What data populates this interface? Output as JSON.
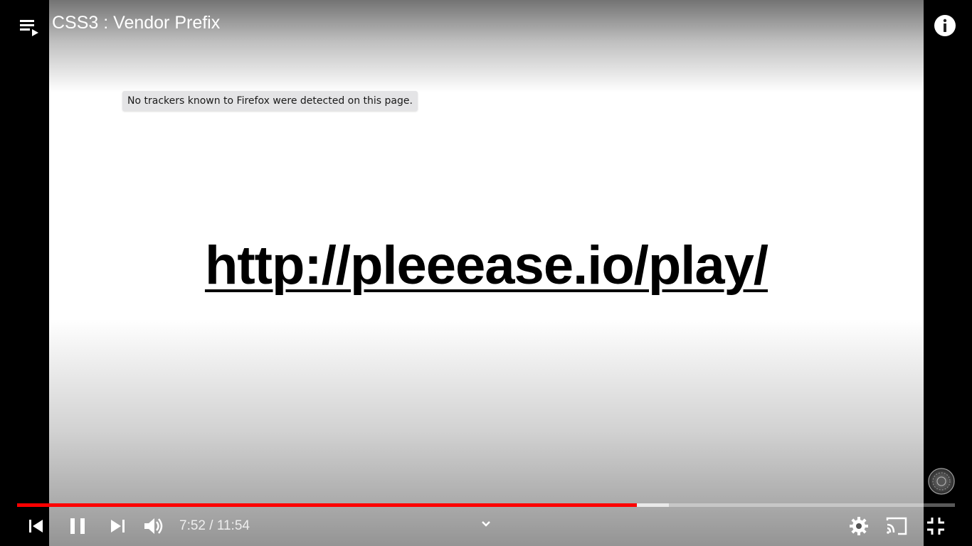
{
  "video": {
    "title": "CSS3 : Vendor Prefix",
    "slide_text": "http://pleeease.io/play/"
  },
  "tooltip": {
    "text": "No trackers known to Firefox were detected on this page."
  },
  "playback": {
    "current_time": "7:52",
    "separator": "/",
    "duration": "11:54",
    "played_fraction": 0.661,
    "buffered_fraction": 0.695,
    "state": "playing"
  },
  "controls": {
    "previous_icon": "skip-previous-icon",
    "pause_icon": "pause-icon",
    "next_icon": "skip-next-icon",
    "volume_icon": "volume-icon",
    "expand_icon": "chevron-down-icon",
    "settings_icon": "gear-icon",
    "cast_icon": "cast-icon",
    "exit_fullscreen_icon": "exit-fullscreen-icon",
    "playlist_icon": "playlist-icon",
    "info_icon": "info-icon"
  },
  "colors": {
    "progress_played": "#ff0000",
    "progress_buffered": "#ffffff99",
    "text": "#ffffff"
  }
}
